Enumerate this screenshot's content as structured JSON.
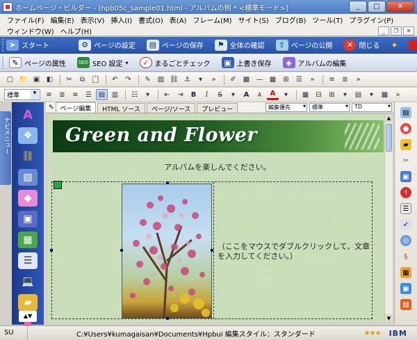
{
  "window": {
    "title": "ホームページ・ビルダー - [hpb05c_sample01.html - アルバムの例 * <標準モード>]",
    "buttons": {
      "minimize": "_",
      "maximize": "□",
      "close": "✕"
    }
  },
  "menu": {
    "row1": [
      "ファイル(F)",
      "編集(E)",
      "表示(V)",
      "挿入(I)",
      "書式(O)",
      "表(A)",
      "フレーム(M)",
      "サイト(S)",
      "ブログ(B)",
      "ツール(T)",
      "プラグイン(P)"
    ],
    "row2": [
      "ウィンドウ(W)",
      "ヘルプ(H)"
    ],
    "mdi": {
      "min": "_",
      "restore": "❐",
      "close": "✕"
    }
  },
  "cmdbar1": [
    {
      "label": "スタート",
      "icon": "start-icon"
    },
    {
      "label": "ページの設定",
      "icon": "page-settings-icon"
    },
    {
      "label": "ページの保存",
      "icon": "save-page-icon"
    },
    {
      "label": "全体の確認",
      "icon": "check-all-icon"
    },
    {
      "label": "ページの公開",
      "icon": "publish-icon"
    },
    {
      "label": "閉じる",
      "icon": "close-doc-icon"
    }
  ],
  "cmdbar2": [
    {
      "label": "ページの属性",
      "icon": "page-attr-icon"
    },
    {
      "label": "SEO 設定",
      "icon": "seo-icon"
    },
    {
      "label": "まるごとチェック",
      "icon": "full-check-icon"
    },
    {
      "label": "上書き保存",
      "icon": "overwrite-save-icon"
    },
    {
      "label": "アルバムの編集",
      "icon": "album-edit-icon"
    }
  ],
  "format": {
    "style": "標準"
  },
  "side_tab": {
    "label": "ナビメニュー"
  },
  "editor_tabs": {
    "items": [
      "ページ編集",
      "HTML ソース",
      "ページ/ソース",
      "プレビュー"
    ],
    "combos": [
      "編集優先",
      "標準",
      "TD"
    ]
  },
  "page": {
    "banner_title": "Green and Flower",
    "subtitle": "アルバムを楽しんでください。",
    "cell_text": "（ここをマウスでダブルクリックして、文章を入力してください。）"
  },
  "status": {
    "mode": "SU",
    "path": "C:¥Users¥kumagaisan¥Documents¥Hpbui 編集スタイル：スタンダード",
    "stars": "★★★",
    "brand": "IBM"
  },
  "colors": {
    "accent": "#2a54a8",
    "page_bg": "#c7ddb7",
    "banner_dark": "#0c3a14"
  }
}
